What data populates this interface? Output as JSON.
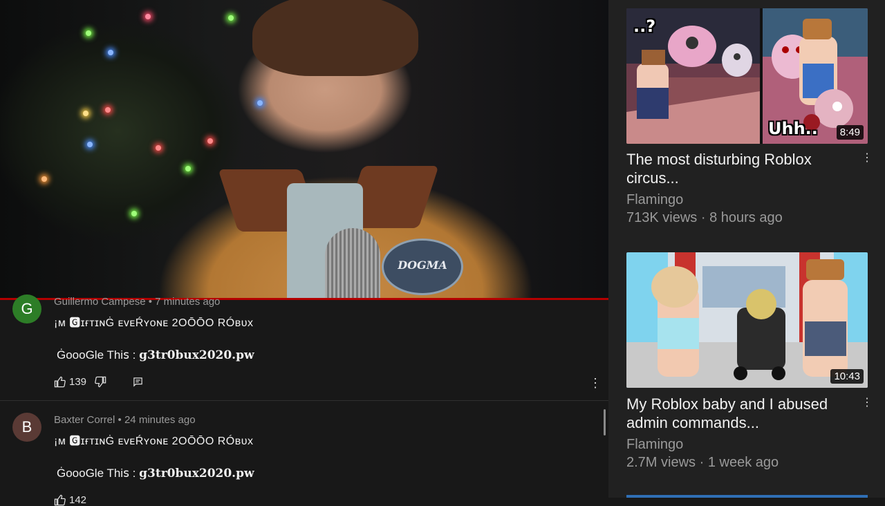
{
  "video": {
    "patch_text": "DOGMA",
    "colors": {
      "progress": "#b40000"
    }
  },
  "comments": [
    {
      "avatar_letter": "G",
      "avatar_color": "#2d7d27",
      "author": "Guillermo Campese",
      "time": "7 minutes ago",
      "line1": "¡ᴍ 🅶ɪғᴛɪɴĠ ᴇᴠᴇŔʏᴏɴᴇ 2OŌŌO RÓʙᴜx",
      "line2_prefix": "ĠoooGle Thiꜱ :",
      "line2_link": "g3tr0bux2020.pw",
      "likes": "139"
    },
    {
      "avatar_letter": "B",
      "avatar_color": "#5a3a35",
      "author": "Baxter Correl",
      "time": "24 minutes ago",
      "line1": "¡ᴍ 🅶ɪғᴛɪɴĠ ᴇᴠᴇŔʏᴏɴᴇ 2OŌŌO RÓʙᴜx",
      "line2_prefix": "ĠoooGle Thiꜱ :",
      "line2_link": "g3tr0bux2020.pw",
      "likes": "142"
    }
  ],
  "icons": {
    "like": "thumb-up-icon",
    "dislike": "thumb-down-icon",
    "reply": "reply-icon",
    "more": "more-vert-icon"
  },
  "separator": "•",
  "sidebar": {
    "videos": [
      {
        "title": "The most disturbing Roblox circus...",
        "channel": "Flamingo",
        "views": "713K views",
        "age": "8 hours ago",
        "duration": "8:49",
        "thumb_text": "Uhh..",
        "thumb_text_2": "..?"
      },
      {
        "title": "My Roblox baby and I abused admin commands...",
        "channel": "Flamingo",
        "views": "2.7M views",
        "age": "1 week ago",
        "duration": "10:43"
      }
    ],
    "dot": "·"
  }
}
